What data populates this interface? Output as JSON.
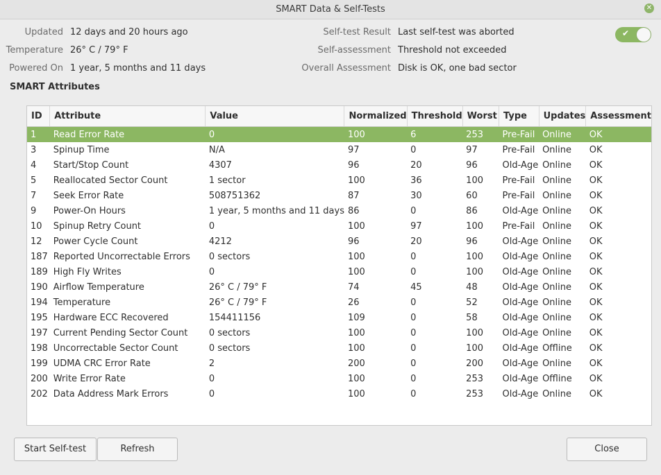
{
  "window": {
    "title": "SMART Data & Self-Tests"
  },
  "info_left": [
    {
      "label": "Updated",
      "value": "12 days and 20 hours ago"
    },
    {
      "label": "Temperature",
      "value": "26° C / 79° F"
    },
    {
      "label": "Powered On",
      "value": "1 year, 5 months and 11 days"
    }
  ],
  "info_right": [
    {
      "label": "Self-test Result",
      "value": "Last self-test was aborted"
    },
    {
      "label": "Self-assessment",
      "value": "Threshold not exceeded"
    },
    {
      "label": "Overall Assessment",
      "value": "Disk is OK, one bad sector"
    }
  ],
  "smart_toggle": {
    "state": "on",
    "icon": "check-icon"
  },
  "section": {
    "title": "SMART Attributes"
  },
  "table": {
    "columns": [
      "ID",
      "Attribute",
      "Value",
      "Normalized",
      "Threshold",
      "Worst",
      "Type",
      "Updates",
      "Assessment"
    ],
    "rows": [
      [
        "1",
        "Read Error Rate",
        "0",
        "100",
        "6",
        "253",
        "Pre-Fail",
        "Online",
        "OK"
      ],
      [
        "3",
        "Spinup Time",
        "N/A",
        "97",
        "0",
        "97",
        "Pre-Fail",
        "Online",
        "OK"
      ],
      [
        "4",
        "Start/Stop Count",
        "4307",
        "96",
        "20",
        "96",
        "Old-Age",
        "Online",
        "OK"
      ],
      [
        "5",
        "Reallocated Sector Count",
        "1 sector",
        "100",
        "36",
        "100",
        "Pre-Fail",
        "Online",
        "OK"
      ],
      [
        "7",
        "Seek Error Rate",
        "508751362",
        "87",
        "30",
        "60",
        "Pre-Fail",
        "Online",
        "OK"
      ],
      [
        "9",
        "Power-On Hours",
        "1 year, 5 months and 11 days",
        "86",
        "0",
        "86",
        "Old-Age",
        "Online",
        "OK"
      ],
      [
        "10",
        "Spinup Retry Count",
        "0",
        "100",
        "97",
        "100",
        "Pre-Fail",
        "Online",
        "OK"
      ],
      [
        "12",
        "Power Cycle Count",
        "4212",
        "96",
        "20",
        "96",
        "Old-Age",
        "Online",
        "OK"
      ],
      [
        "187",
        "Reported Uncorrectable Errors",
        "0 sectors",
        "100",
        "0",
        "100",
        "Old-Age",
        "Online",
        "OK"
      ],
      [
        "189",
        "High Fly Writes",
        "0",
        "100",
        "0",
        "100",
        "Old-Age",
        "Online",
        "OK"
      ],
      [
        "190",
        "Airflow Temperature",
        "26° C / 79° F",
        "74",
        "45",
        "48",
        "Old-Age",
        "Online",
        "OK"
      ],
      [
        "194",
        "Temperature",
        "26° C / 79° F",
        "26",
        "0",
        "52",
        "Old-Age",
        "Online",
        "OK"
      ],
      [
        "195",
        "Hardware ECC Recovered",
        "154411156",
        "109",
        "0",
        "58",
        "Old-Age",
        "Online",
        "OK"
      ],
      [
        "197",
        "Current Pending Sector Count",
        "0 sectors",
        "100",
        "0",
        "100",
        "Old-Age",
        "Online",
        "OK"
      ],
      [
        "198",
        "Uncorrectable Sector Count",
        "0 sectors",
        "100",
        "0",
        "100",
        "Old-Age",
        "Offline",
        "OK"
      ],
      [
        "199",
        "UDMA CRC Error Rate",
        "2",
        "200",
        "0",
        "200",
        "Old-Age",
        "Online",
        "OK"
      ],
      [
        "200",
        "Write Error Rate",
        "0",
        "100",
        "0",
        "253",
        "Old-Age",
        "Offline",
        "OK"
      ],
      [
        "202",
        "Data Address Mark Errors",
        "0",
        "100",
        "0",
        "253",
        "Old-Age",
        "Online",
        "OK"
      ]
    ],
    "selected_row": 0
  },
  "buttons": {
    "start_self_test": "Start Self-test",
    "refresh": "Refresh",
    "close": "Close"
  },
  "colors": {
    "accent": "#8cb762",
    "background": "#ececec"
  }
}
